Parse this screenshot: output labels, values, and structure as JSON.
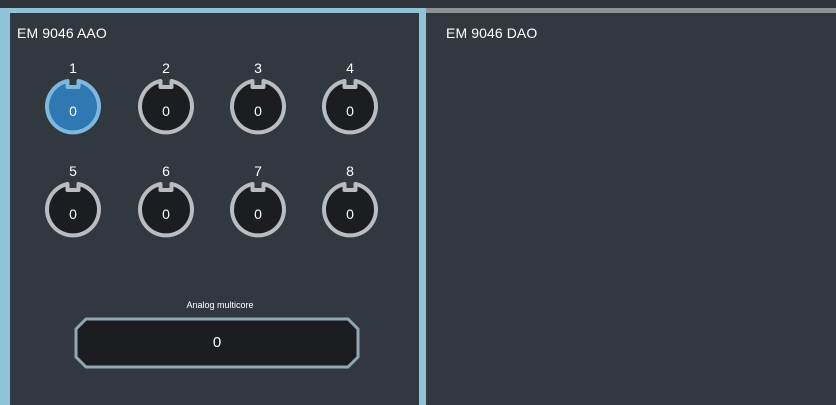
{
  "left_panel": {
    "title": "EM 9046 AAO",
    "channels": [
      {
        "number": "1",
        "value": "0",
        "selected": true
      },
      {
        "number": "2",
        "value": "0",
        "selected": false
      },
      {
        "number": "3",
        "value": "0",
        "selected": false
      },
      {
        "number": "4",
        "value": "0",
        "selected": false
      },
      {
        "number": "5",
        "value": "0",
        "selected": false
      },
      {
        "number": "6",
        "value": "0",
        "selected": false
      },
      {
        "number": "7",
        "value": "0",
        "selected": false
      },
      {
        "number": "8",
        "value": "0",
        "selected": false
      }
    ],
    "multicore": {
      "label": "Analog multicore",
      "value": "0"
    }
  },
  "right_panel": {
    "title": "EM 9046 DAO"
  },
  "colors": {
    "background": "#2e333b",
    "panel": "#323840",
    "selected_border": "#8fc3d8",
    "unselected_border": "#8e9094",
    "connector_ring": "#b9bcc0",
    "connector_fill": "#1b1d20",
    "selected_ring": "#7fb8dd",
    "selected_fill": "#2f78b3",
    "multicore_border": "#8fa8b4",
    "multicore_fill": "#1b1d20"
  }
}
